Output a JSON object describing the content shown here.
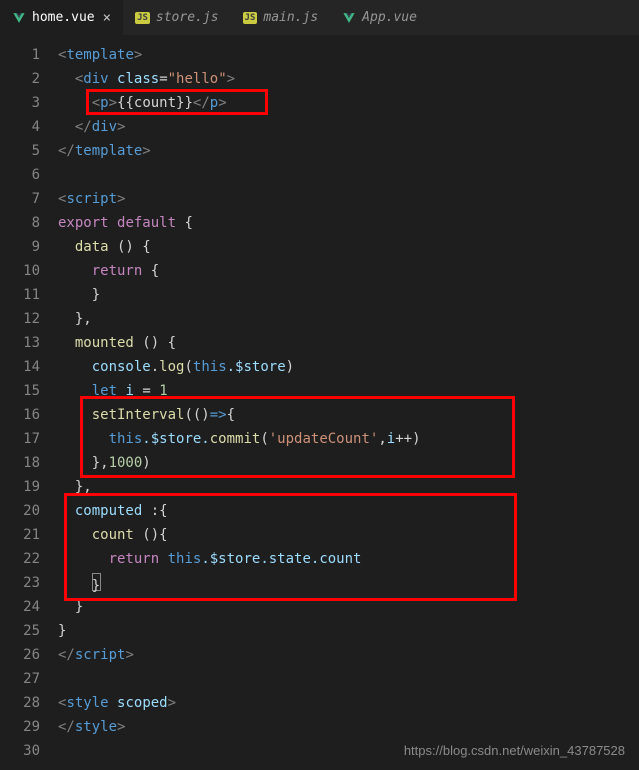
{
  "tabs": [
    {
      "label": "home.vue",
      "type": "vue",
      "active": true
    },
    {
      "label": "store.js",
      "type": "js",
      "active": false
    },
    {
      "label": "main.js",
      "type": "js",
      "active": false
    },
    {
      "label": "App.vue",
      "type": "vue",
      "active": false
    }
  ],
  "lines": {
    "l1": {
      "tag_open": "<",
      "tagname": "template",
      "tag_close": ">"
    },
    "l2": {
      "tag_open": "<",
      "tagname": "div",
      "attr": "class",
      "eq": "=",
      "val": "\"hello\"",
      "tag_close": ">"
    },
    "l3": {
      "po": "<",
      "pn": "p",
      "pc": ">",
      "expr": "{{count}}",
      "co": "</",
      "cn": "p",
      "cc": ">"
    },
    "l4": {
      "co": "</",
      "cn": "div",
      "cc": ">"
    },
    "l5": {
      "co": "</",
      "cn": "template",
      "cc": ">"
    },
    "l7": {
      "tag_open": "<",
      "tagname": "script",
      "tag_close": ">"
    },
    "l8": {
      "kw1": "export",
      "kw2": "default",
      "brace": " {"
    },
    "l9": {
      "fn": "data",
      "paren": " () {"
    },
    "l10": {
      "ret": "return",
      "brace": " {"
    },
    "l11": {
      "brace": "}"
    },
    "l12": {
      "brace": "},"
    },
    "l13": {
      "fn": "mounted",
      "paren": " () {"
    },
    "l14": {
      "obj": "console",
      "dot": ".",
      "fn": "log",
      "po": "(",
      "this": "this",
      "prop": ".$store",
      "pc": ")"
    },
    "l15": {
      "let": "let",
      "var": "i",
      "eq": " = ",
      "num": "1"
    },
    "l16": {
      "fn": "setInterval",
      "po": "(()",
      "arrow": "=>",
      "brace": "{"
    },
    "l17": {
      "this": "this",
      "prop1": ".$store.",
      "fn": "commit",
      "po": "(",
      "str": "'updateCount'",
      "comma": ",",
      "var": "i",
      "inc": "++",
      "pc": ")"
    },
    "l18": {
      "brace": "},",
      "num": "1000",
      "pc": ")"
    },
    "l19": {
      "brace": "},"
    },
    "l20": {
      "prop": "computed",
      "colon": " :{"
    },
    "l21": {
      "fn": "count",
      "paren": " (){"
    },
    "l22": {
      "ret": "return",
      "sp": " ",
      "this": "this",
      "prop": ".$store.state.count"
    },
    "l23": {
      "brace": "}"
    },
    "l24": {
      "brace": "}"
    },
    "l25": {
      "brace": "}"
    },
    "l26": {
      "co": "</",
      "cn": "script",
      "cc": ">"
    },
    "l28": {
      "tag_open": "<",
      "tagname": "style",
      "attr": "scoped",
      "tag_close": ">"
    },
    "l29": {
      "co": "</",
      "cn": "style",
      "cc": ">"
    }
  },
  "watermark": "https://blog.csdn.net/weixin_43787528",
  "line_numbers": [
    "1",
    "2",
    "3",
    "4",
    "5",
    "6",
    "7",
    "8",
    "9",
    "10",
    "11",
    "12",
    "13",
    "14",
    "15",
    "16",
    "17",
    "18",
    "19",
    "20",
    "21",
    "22",
    "23",
    "24",
    "25",
    "26",
    "27",
    "28",
    "29",
    "30"
  ]
}
